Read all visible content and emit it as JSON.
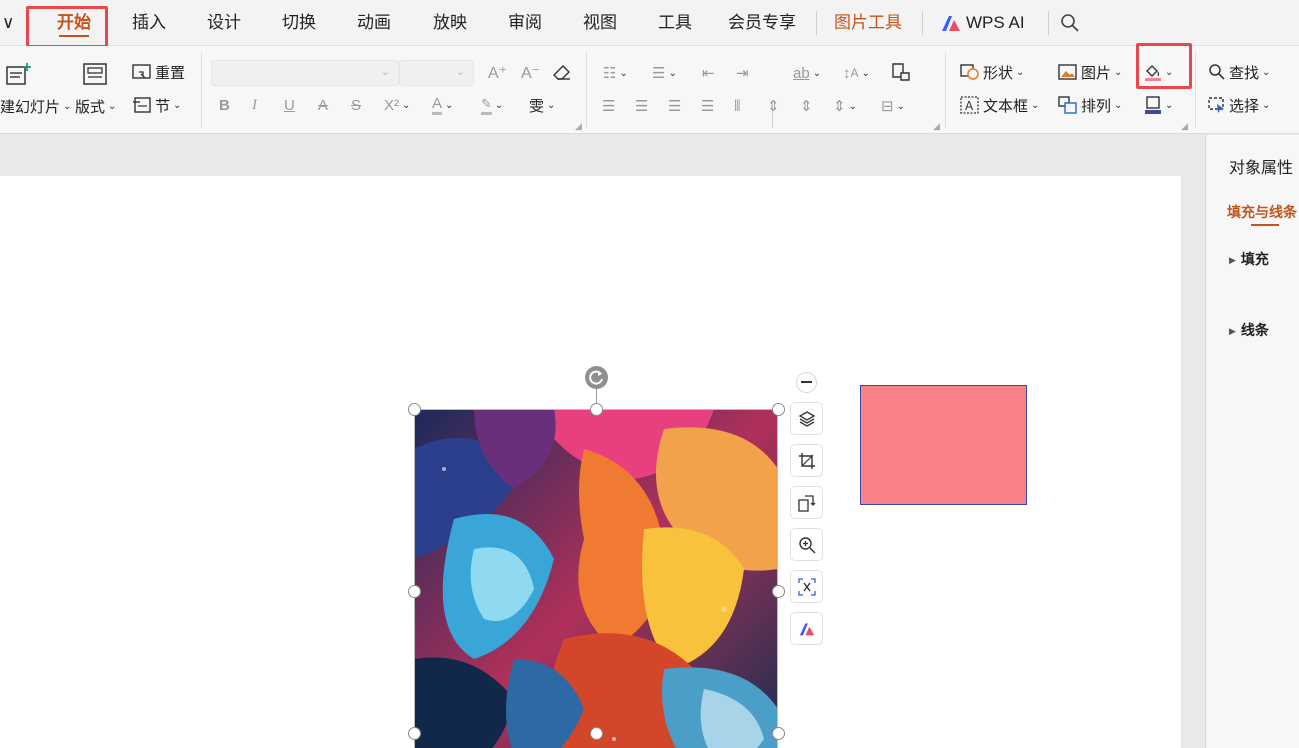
{
  "menu": {
    "tabs": [
      {
        "label": "开始",
        "active": true
      },
      {
        "label": "插入"
      },
      {
        "label": "设计"
      },
      {
        "label": "切换"
      },
      {
        "label": "动画"
      },
      {
        "label": "放映"
      },
      {
        "label": "审阅"
      },
      {
        "label": "视图"
      },
      {
        "label": "工具"
      },
      {
        "label": "会员专享"
      },
      {
        "label": "图片工具",
        "contextual": true
      },
      {
        "label": "WPS AI"
      }
    ],
    "collapse_glyph": "∨",
    "search_icon": "search-icon"
  },
  "ribbon": {
    "slides": {
      "new_slide_label": "建幻灯片",
      "layout_label": "版式",
      "reset_label": "重置",
      "section_label": "节"
    },
    "font": {
      "font_name": "",
      "font_size": "",
      "bold": "B",
      "italic": "I",
      "underline": "U",
      "strike": "A",
      "shadow": "S",
      "superscript": "X²",
      "font_color": "A",
      "format_brush": "ab"
    },
    "paragraph": {
      "line_spacing": "↕",
      "text_direction": "ab"
    },
    "drawing": {
      "shape_label": "形状",
      "textbox_label": "文本框",
      "picture_label": "图片",
      "arrange_label": "排列"
    },
    "editing": {
      "find_label": "查找",
      "select_label": "选择"
    }
  },
  "canvas": {
    "image_alt": "abstract colorful fluid paint artwork",
    "fill_rect_color": "#f8818a",
    "fill_rect_border": "#3b49a6"
  },
  "panel": {
    "title": "对象属性",
    "active_tab": "填充与线条",
    "sections": [
      "填充",
      "线条"
    ]
  },
  "colors": {
    "accent": "#c4541b",
    "highlight": "#e8474d",
    "ai_brand_blue": "#3a5bff"
  }
}
